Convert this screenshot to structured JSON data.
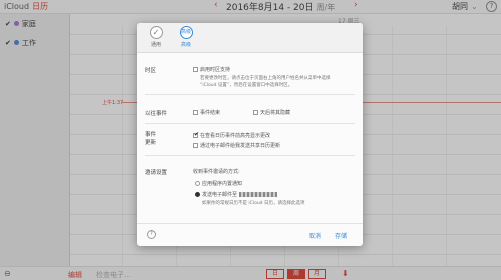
{
  "topbar": {
    "brand": "iCloud",
    "app_name": "日历",
    "prev_icon": "‹",
    "next_icon": "›",
    "date_range": "2016年8月14 - 20日",
    "week_year": "周/年",
    "user": "胡同",
    "user_chevron": "⌄",
    "help": "?"
  },
  "sidebar": {
    "items": [
      {
        "check": "✔",
        "label": "家庭",
        "color": "#9b6fc4"
      },
      {
        "check": "✔",
        "label": "工作",
        "color": "#4d7fd1"
      }
    ]
  },
  "calendar": {
    "day_headers": [
      "",
      "",
      "",
      "",
      "17 周三",
      "",
      ""
    ],
    "hours": [
      "下午",
      "下午1:00",
      "下午2:00",
      "下午3:00",
      "下午4:00",
      "下午5:00",
      "下午6:00",
      "下午7:00",
      "下午8:00",
      "下午9:00",
      "下午10:00",
      "下午11:00"
    ],
    "now_label": "上午1:37",
    "now_color": "#d93a2b"
  },
  "dialog": {
    "tabs": [
      {
        "label": "通用",
        "icon": "✓"
      },
      {
        "label": "高级",
        "icon": "高级"
      }
    ],
    "timezone": {
      "label": "时区",
      "option": "启用时区支持",
      "desc_line1": "若要更改时区，请点击位于页面右上角的用户姓名并从菜单中选择",
      "desc_line2": "“iCloud 设置”，然后在设置窗口中选择时区。"
    },
    "past_events": {
      "label": "以往事件",
      "option1": "事件结束",
      "option2": "天后将其隐藏"
    },
    "event_update": {
      "label_line1": "事件",
      "label_line2": "更新",
      "option1": "在查看日历事件前高亮显示更改",
      "option2": "通过电子邮件给我发送共享日历更新"
    },
    "invitations": {
      "label": "邀请设置",
      "heading": "收到事件邀请的方式:",
      "option1": "应用程序内置通知",
      "option2_prefix": "发送电子邮件至",
      "note": "如果你的常规日历不是 iCloud 日历，请选择此选项"
    },
    "footer": {
      "help": "?",
      "cancel": "取消",
      "save": "存储"
    }
  },
  "bottombar": {
    "edit_icon": "⊖",
    "edit_label": "编辑",
    "search_placeholder": "检查电子...",
    "segments": [
      "日",
      "周",
      "月"
    ],
    "active_segment": 1,
    "trash_icon": "⬇"
  },
  "accent_color": "#d93a2b",
  "link_color": "#3a88d6"
}
